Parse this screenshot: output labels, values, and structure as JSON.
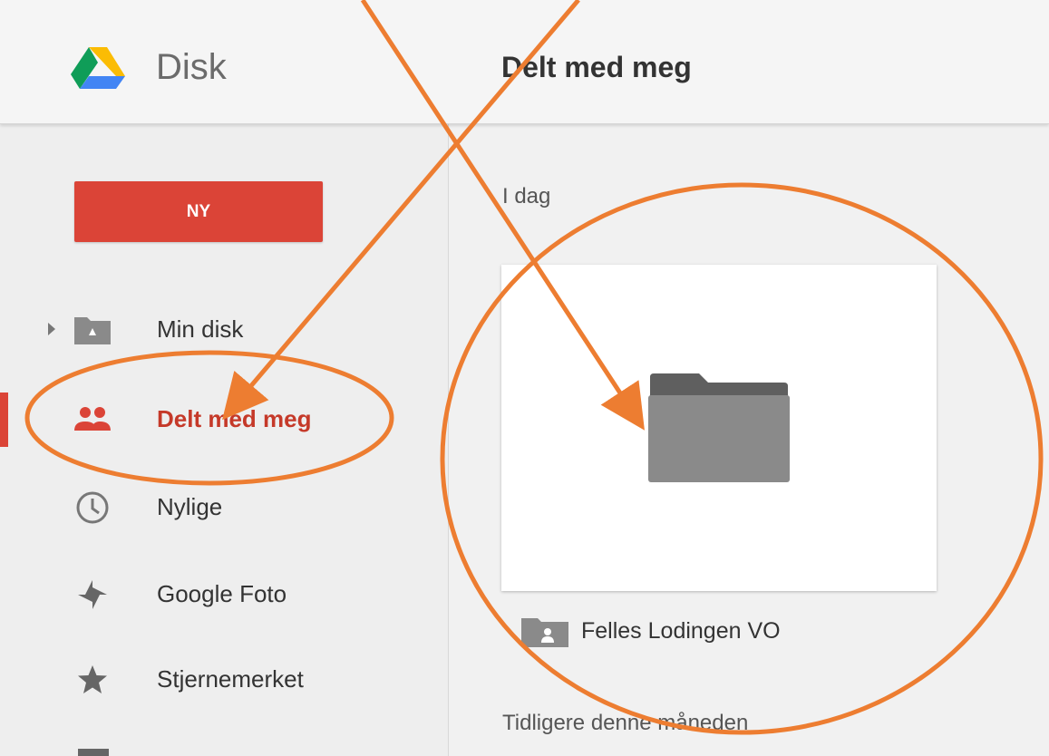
{
  "header": {
    "brand": "Disk",
    "page_title": "Delt med meg",
    "logo_icon": "google-drive-logo-icon"
  },
  "sidebar": {
    "new_button_label": "NY",
    "items": [
      {
        "label": "Min disk",
        "icon": "drive-folder-icon"
      },
      {
        "label": "Delt med meg",
        "icon": "people-icon",
        "active": true
      },
      {
        "label": "Nylige",
        "icon": "clock-icon"
      },
      {
        "label": "Google Foto",
        "icon": "pinwheel-icon"
      },
      {
        "label": "Stjernemerket",
        "icon": "star-icon"
      }
    ]
  },
  "main": {
    "section_today": "I dag",
    "folder": {
      "name": "Felles Lodingen VO",
      "icon": "shared-folder-icon"
    },
    "section_earlier": "Tidligere denne måneden"
  },
  "annotations": {
    "color": "#ed7d31"
  },
  "colors": {
    "accent": "#db4437",
    "active_text": "#c53929"
  }
}
